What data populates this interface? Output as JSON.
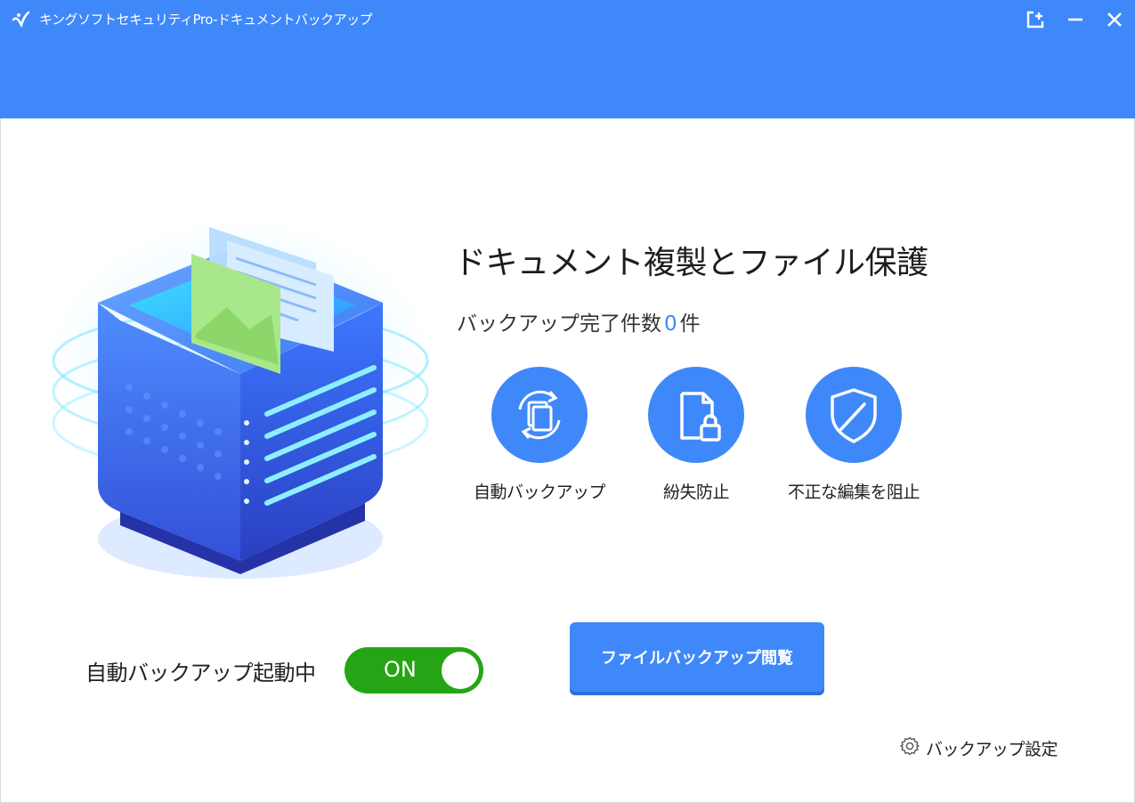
{
  "window": {
    "title": "キングソフトセキュリティPro-ドキュメントバックアップ",
    "controls": [
      "new-window-icon",
      "minimize-icon",
      "close-icon"
    ]
  },
  "colors": {
    "accent": "#3f88fa",
    "toggle_on": "#25a515"
  },
  "main": {
    "title": "ドキュメント複製とファイル保護",
    "count_prefix": "バックアップ完了件数",
    "count_value": "0",
    "count_suffix": "件"
  },
  "features": [
    {
      "icon": "auto-backup-icon",
      "label": "自動バックアップ"
    },
    {
      "icon": "file-lock-icon",
      "label": "紛失防止"
    },
    {
      "icon": "shield-icon",
      "label": "不正な編集を阻止"
    }
  ],
  "auto_backup": {
    "label": "自動バックアップ起動中",
    "toggle_text": "ON",
    "enabled": true
  },
  "browse_button": {
    "label": "ファイルバックアップ閲覧"
  },
  "settings_link": {
    "label": "バックアップ設定",
    "icon": "gear-icon"
  }
}
